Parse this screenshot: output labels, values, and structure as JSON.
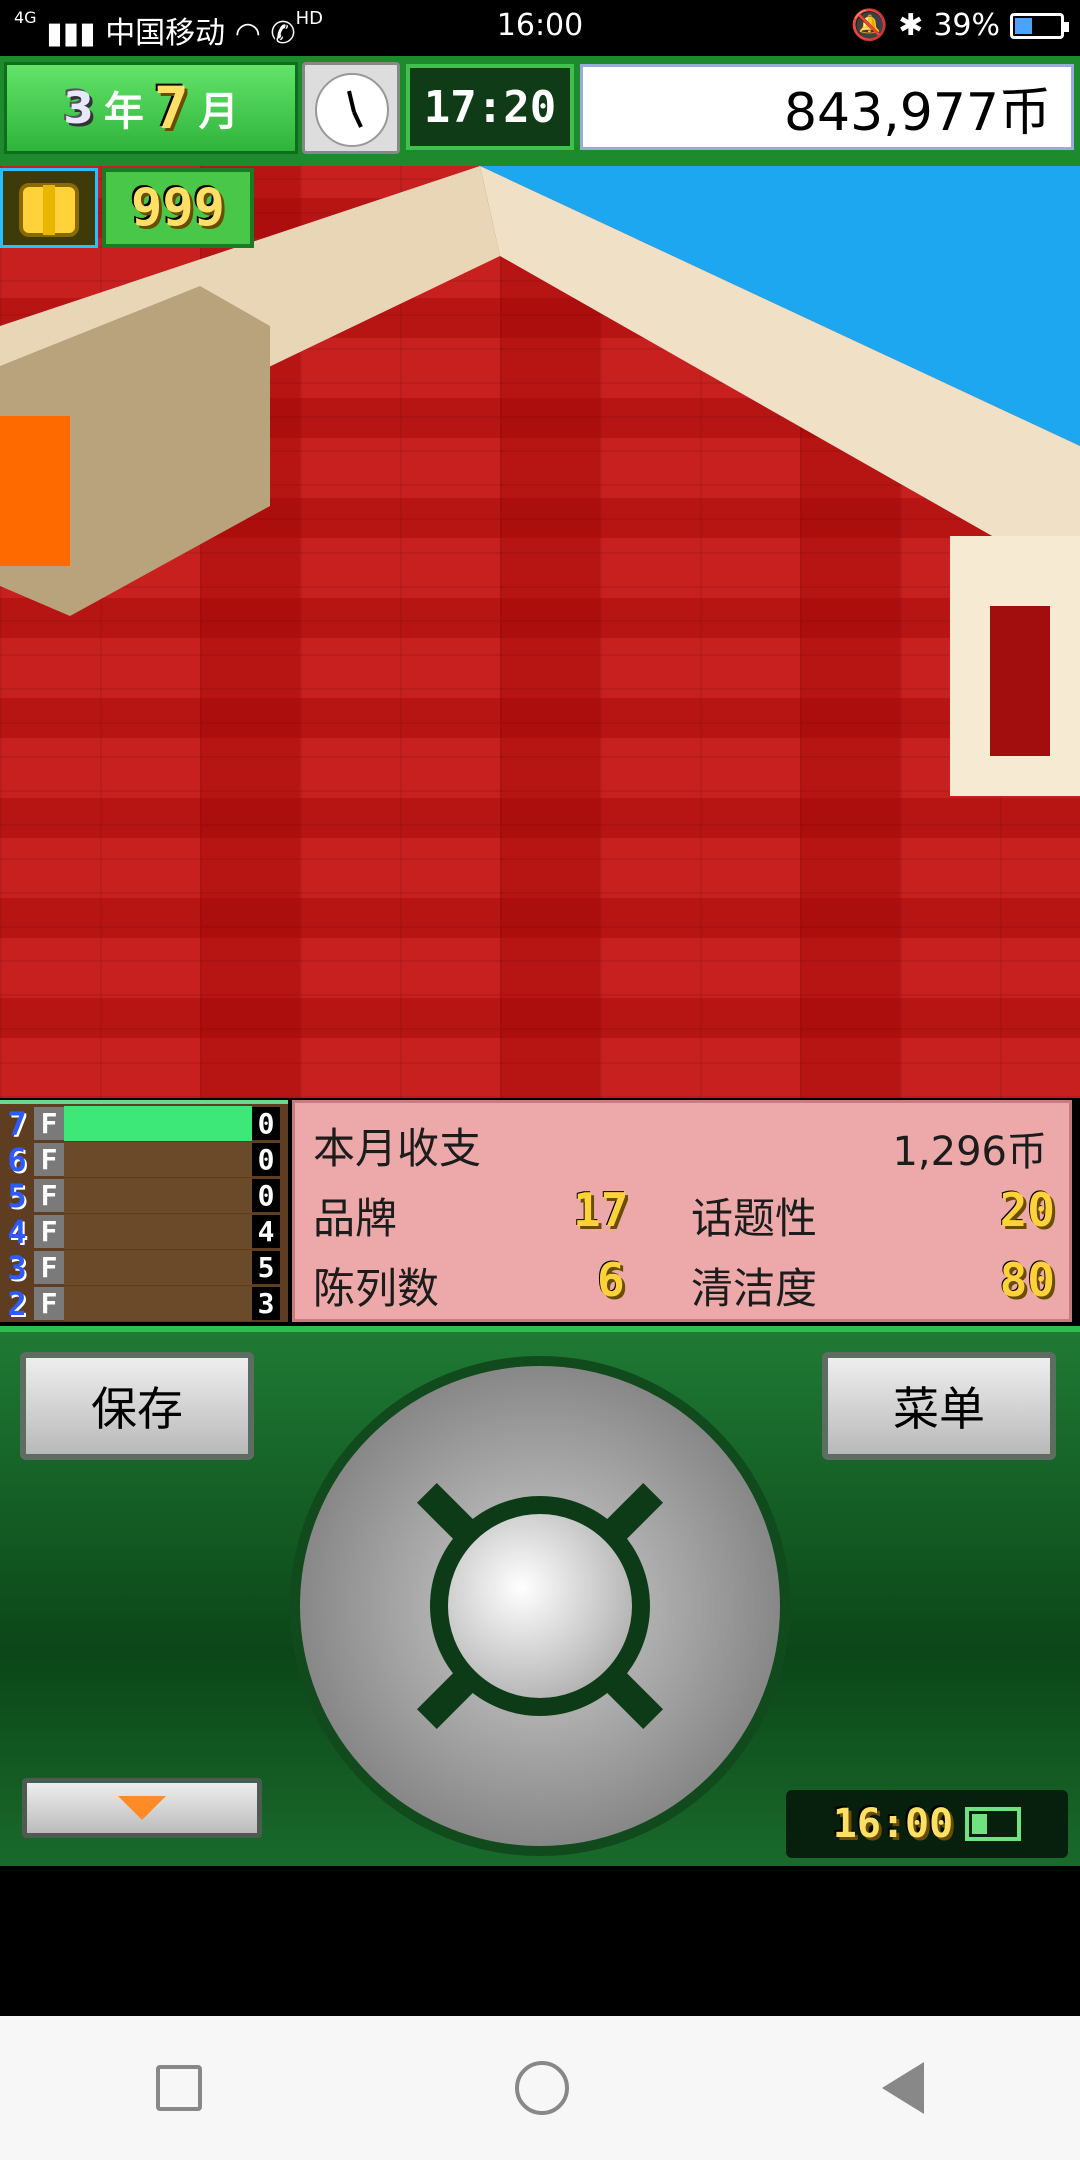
{
  "status_bar": {
    "carrier": "中国移动",
    "time": "16:00",
    "battery": "39%",
    "hd_label": "HD",
    "net_label": "4G"
  },
  "hud": {
    "year_num": "3",
    "year_label": "年",
    "month_num": "7",
    "month_label": "月",
    "game_time": "17:20",
    "money": "843,977币",
    "gift_count": "999"
  },
  "floors": [
    {
      "num": "7",
      "f": "F",
      "value": "0",
      "active": true
    },
    {
      "num": "6",
      "f": "F",
      "value": "0",
      "active": false
    },
    {
      "num": "5",
      "f": "F",
      "value": "0",
      "active": false
    },
    {
      "num": "4",
      "f": "F",
      "value": "4",
      "active": false
    },
    {
      "num": "3",
      "f": "F",
      "value": "5",
      "active": false
    },
    {
      "num": "2",
      "f": "F",
      "value": "3",
      "active": false
    }
  ],
  "stats": {
    "monthly_label": "本月收支",
    "monthly_value": "1,296币",
    "brand_label": "品牌",
    "brand_value": "17",
    "topic_label": "话题性",
    "topic_value": "20",
    "display_label": "陈列数",
    "display_value": "6",
    "clean_label": "清洁度",
    "clean_value": "80"
  },
  "controller": {
    "save_label": "保存",
    "menu_label": "菜单",
    "mini_time": "16:00",
    "mini_battery_level": 0.3
  },
  "icons": {
    "gift": "gift-icon",
    "clock": "clock-icon",
    "dpad": "dpad-icon",
    "down_arrow": "down-arrow-icon",
    "battery": "battery-icon",
    "wifi": "wifi-icon",
    "bluetooth": "bluetooth-icon",
    "bell_mute": "bell-mute-icon",
    "phone_hd": "phone-hd-icon"
  }
}
